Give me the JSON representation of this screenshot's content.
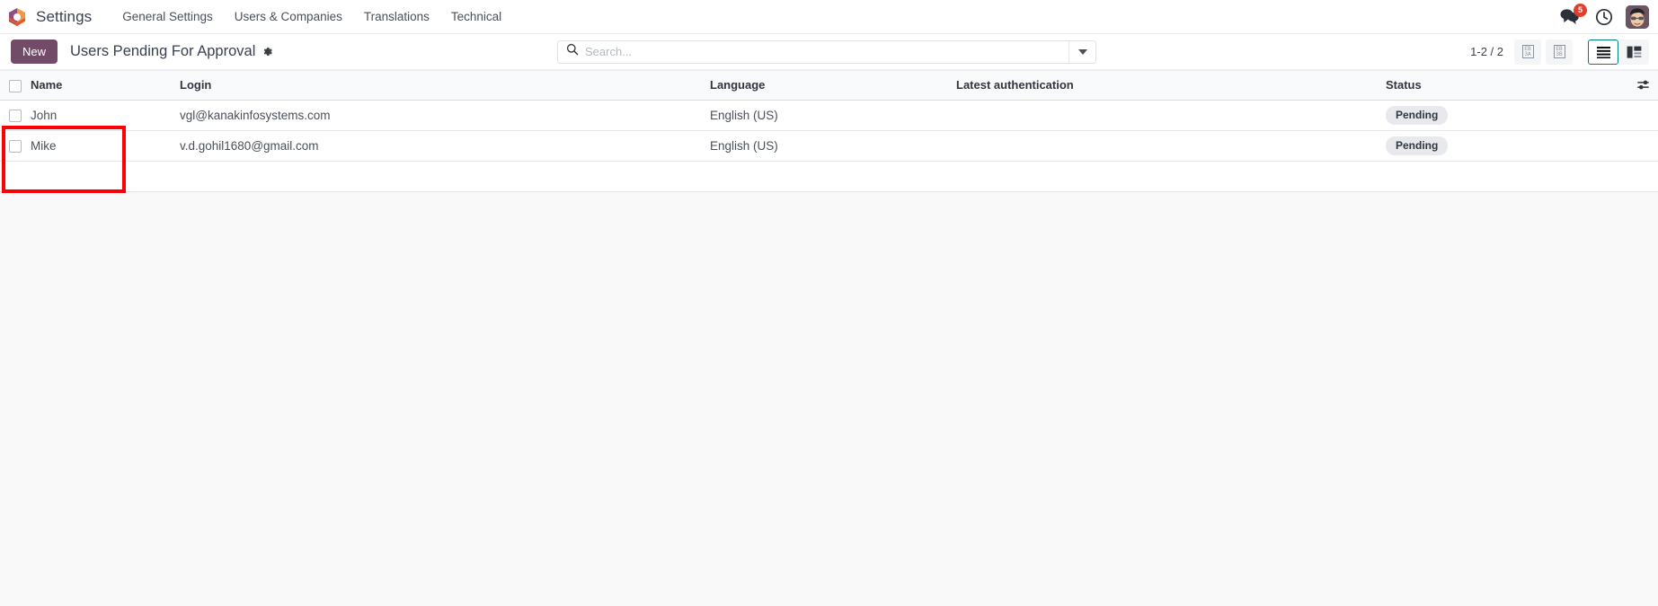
{
  "navbar": {
    "logo_icon": "odoo-hexagon-logo",
    "app_name": "Settings",
    "menu": [
      {
        "label": "General Settings"
      },
      {
        "label": "Users & Companies"
      },
      {
        "label": "Translations"
      },
      {
        "label": "Technical"
      }
    ],
    "messages_icon": "messages-icon",
    "messages_count": "5",
    "activities_icon": "clock-icon",
    "avatar_icon": "user-avatar",
    "badge_color": "#e13f2b"
  },
  "control_panel": {
    "new_label": "New",
    "title": "Users Pending For Approval",
    "settings_icon": "gear-icon",
    "search": {
      "icon": "search-icon",
      "placeholder": "Search...",
      "value": "",
      "toggle_icon": "chevron-down-icon"
    },
    "pager": "1-2 / 2",
    "prev_icon": "chevron-left-icon",
    "prev_glyph": "EB\n3A",
    "next_icon": "chevron-right-icon",
    "next_glyph": "EB\n3B",
    "views": [
      {
        "name": "list-view",
        "icon": "list-icon",
        "active": true
      },
      {
        "name": "kanban-view",
        "icon": "kanban-icon",
        "active": false
      }
    ],
    "active_view_color": "#017e84"
  },
  "list": {
    "columns": [
      {
        "key": "select",
        "label": ""
      },
      {
        "key": "name",
        "label": "Name"
      },
      {
        "key": "login",
        "label": "Login"
      },
      {
        "key": "language",
        "label": "Language"
      },
      {
        "key": "latest_authentication",
        "label": "Latest authentication"
      },
      {
        "key": "status",
        "label": "Status"
      }
    ],
    "optional_columns_icon": "sliders-icon",
    "rows": [
      {
        "name": "John",
        "login": "vgl@kanakinfosystems.com",
        "language": "English (US)",
        "latest_authentication": "",
        "status": "Pending"
      },
      {
        "name": "Mike",
        "login": "v.d.gohil1680@gmail.com",
        "language": "English (US)",
        "latest_authentication": "",
        "status": "Pending"
      }
    ]
  },
  "annotation": {
    "name": "highlight-box-name-column",
    "color": "#fb0007"
  }
}
